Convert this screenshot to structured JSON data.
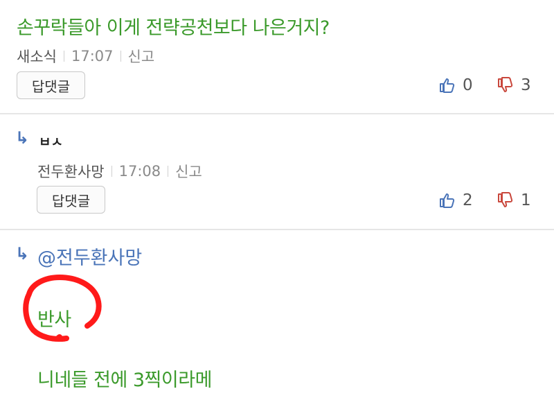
{
  "comment1": {
    "text": "손꾸락들아 이게 전략공천보다 나은거지?",
    "author": "새소식",
    "time": "17:07",
    "report": "신고",
    "reply_button": "답댓글",
    "likes": "0",
    "dislikes": "3"
  },
  "comment2": {
    "text": "ㅂㅅ",
    "author": "전두환사망",
    "time": "17:08",
    "report": "신고",
    "reply_button": "답댓글",
    "likes": "2",
    "dislikes": "1"
  },
  "comment3": {
    "mention": "@전두환사망",
    "line1": "반사",
    "line2": "니네들 전에 3찍이라메"
  },
  "icons": {
    "reply_arrow": "reply-arrow-icon",
    "thumb_up": "thumb-up-icon",
    "thumb_down": "thumb-down-icon"
  },
  "colors": {
    "comment_text": "#3b9a2b",
    "mention": "#4a74b8",
    "annotation": "#ff1a1a",
    "like_icon": "#4a74b8",
    "dislike_icon": "#c9473c"
  }
}
